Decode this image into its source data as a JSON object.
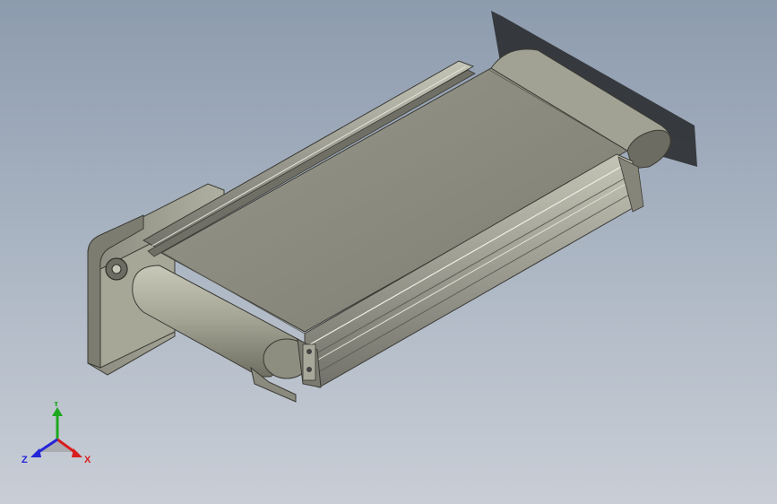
{
  "viewport": {
    "background_top": "#8d9bae",
    "background_bottom": "#c9ced6"
  },
  "model": {
    "belt_color": "#8a8a7c",
    "frame_color": "#9a9a8e",
    "rail_color": "#b8b8ac"
  },
  "triad": {
    "x_label": "X",
    "y_label": "Y",
    "z_label": "Z",
    "x_color": "#d81e1e",
    "y_color": "#1ea81e",
    "z_color": "#2424d8"
  }
}
